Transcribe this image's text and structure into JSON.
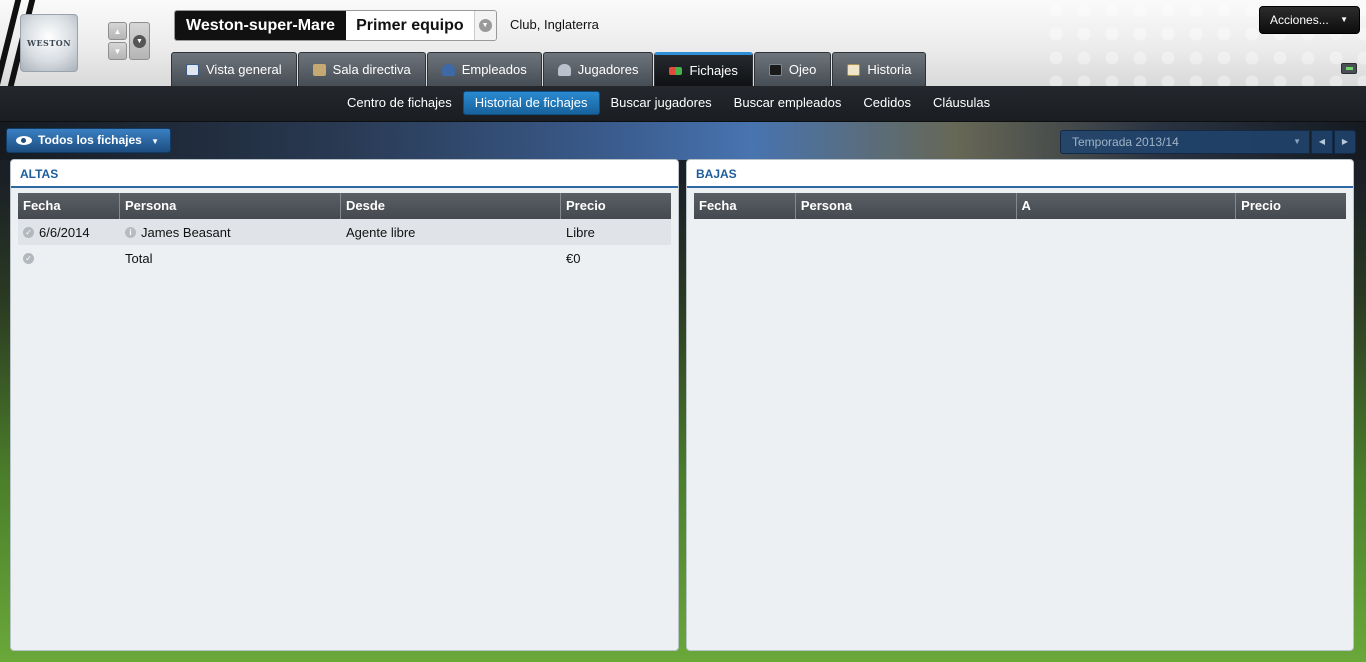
{
  "header": {
    "club_name": "Weston-super-Mare",
    "team_name": "Primer equipo",
    "club_subtitle": "Club, Inglaterra",
    "actions_label": "Acciones...",
    "crest_text": "WESTON"
  },
  "tabs": [
    {
      "label": "Vista general",
      "icon": "overview-icon"
    },
    {
      "label": "Sala directiva",
      "icon": "boardroom-icon"
    },
    {
      "label": "Empleados",
      "icon": "staff-icon"
    },
    {
      "label": "Jugadores",
      "icon": "players-icon"
    },
    {
      "label": "Fichajes",
      "icon": "transfers-icon",
      "active": true
    },
    {
      "label": "Ojeo",
      "icon": "binoculars-icon"
    },
    {
      "label": "Historia",
      "icon": "history-icon"
    }
  ],
  "subnav": [
    {
      "label": "Centro de fichajes"
    },
    {
      "label": "Historial de fichajes",
      "active": true
    },
    {
      "label": "Buscar jugadores"
    },
    {
      "label": "Buscar empleados"
    },
    {
      "label": "Cedidos"
    },
    {
      "label": "Cláusulas"
    }
  ],
  "filter": {
    "view_label": "Todos los fichajes",
    "season": "Temporada 2013/14"
  },
  "altas": {
    "title": "ALTAS",
    "columns": [
      "Fecha",
      "Persona",
      "Desde",
      "Precio"
    ],
    "rows": [
      {
        "fecha": "6/6/2014",
        "persona": "James Beasant",
        "desde": "Agente libre",
        "precio": "Libre"
      }
    ],
    "total": {
      "label": "Total",
      "precio": "€0"
    }
  },
  "bajas": {
    "title": "BAJAS",
    "columns": [
      "Fecha",
      "Persona",
      "A",
      "Precio"
    ],
    "rows": []
  },
  "colors": {
    "accent": "#2d6aa3",
    "active_tab_bar": "#2f8fd6",
    "subnav_active": "#1e73b5"
  }
}
